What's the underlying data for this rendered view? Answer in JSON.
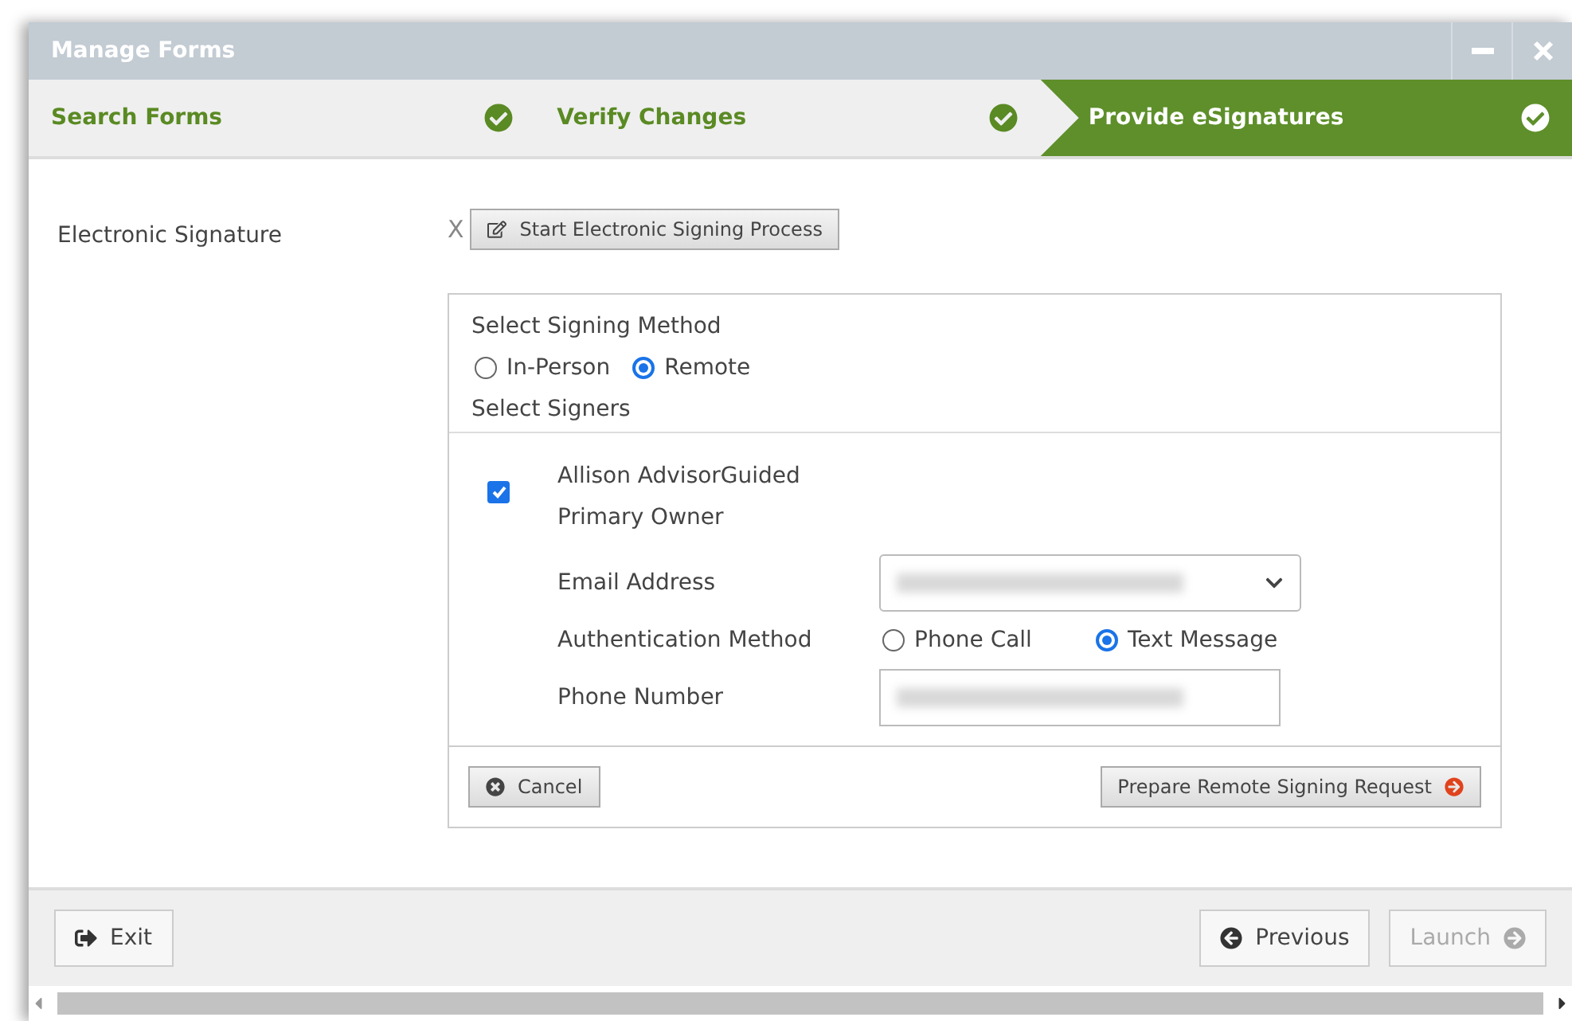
{
  "window": {
    "title": "Manage Forms"
  },
  "steps": [
    {
      "label": "Search Forms",
      "selected": false,
      "done": true
    },
    {
      "label": "Verify Changes",
      "selected": false,
      "done": true
    },
    {
      "label": "Provide eSignatures",
      "selected": true,
      "done": true
    }
  ],
  "field_label": "Electronic Signature",
  "remove_mark": "X",
  "start_button": "Start Electronic Signing Process",
  "signing_method": {
    "title": "Select Signing Method",
    "options": [
      {
        "label": "In-Person",
        "selected": false
      },
      {
        "label": "Remote",
        "selected": true
      }
    ]
  },
  "signers_title": "Select Signers",
  "signer": {
    "name": "Allison AdvisorGuided",
    "role": "Primary Owner",
    "checked": true,
    "email_label": "Email Address",
    "auth_label": "Authentication Method",
    "auth_options": [
      {
        "label": "Phone Call",
        "selected": false
      },
      {
        "label": "Text Message",
        "selected": true
      }
    ],
    "phone_label": "Phone Number"
  },
  "cancel_button": "Cancel",
  "prepare_button": "Prepare Remote Signing Request",
  "footer": {
    "exit": "Exit",
    "previous": "Previous",
    "launch": {
      "label": "Launch",
      "disabled": true
    }
  }
}
